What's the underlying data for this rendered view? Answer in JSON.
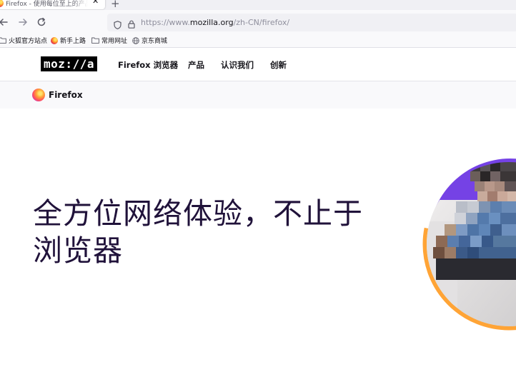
{
  "browser": {
    "tab": {
      "title": "Firefox - 使用每位至上的产品...",
      "close_glyph": "✕"
    },
    "new_tab_glyph": "+",
    "nav": {
      "back_icon": "back-arrow-icon",
      "forward_icon": "forward-arrow-icon",
      "reload_icon": "reload-icon"
    },
    "url": {
      "prefix": "https://www.",
      "domain": "mozilla.org",
      "path": "/zh-CN/firefox/"
    },
    "bookmarks": [
      {
        "label": "火狐官方站点",
        "icon": "folder-icon"
      },
      {
        "label": "新手上路",
        "icon": "firefox-icon"
      },
      {
        "label": "常用网址",
        "icon": "folder-icon"
      },
      {
        "label": "京东商城",
        "icon": "globe-icon"
      }
    ]
  },
  "site": {
    "logo": "moz://a",
    "nav": [
      "Firefox 浏览器",
      "产品",
      "认识我们",
      "创新"
    ],
    "subnav": {
      "brand": "Firefox"
    }
  },
  "hero": {
    "title": "全方位网络体验，不止于浏览器"
  },
  "colors": {
    "hero_text": "#20123a",
    "hero_arc_orange": "#ffa436",
    "hero_arc_purple": "#7542e5"
  }
}
